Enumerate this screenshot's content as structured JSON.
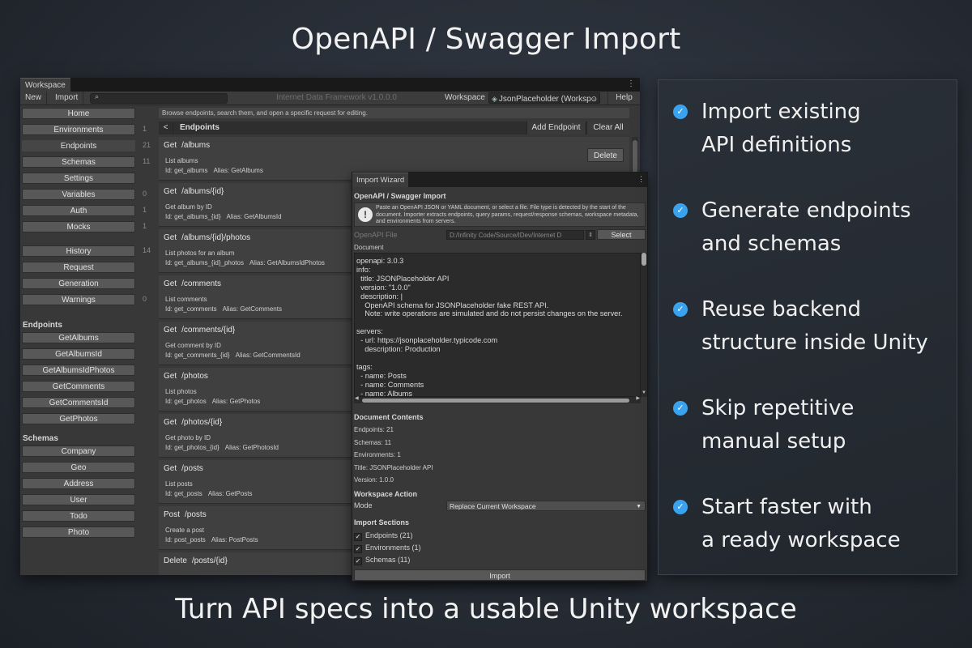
{
  "hero": {
    "title": "OpenAPI / Swagger Import",
    "subtitle": "Turn API specs into a usable Unity workspace"
  },
  "editor": {
    "tab": "Workspace",
    "menu_icon": "kebab-icon",
    "toolbar": {
      "new": "New",
      "import": "Import",
      "search_placeholder": "",
      "title": "Internet Data Framework v1.0.0.0",
      "workspace_label": "Workspace",
      "workspace_value": "JsonPlaceholder (Worksp",
      "help": "Help"
    },
    "sidebar": {
      "main_items": [
        {
          "label": "Home",
          "count": ""
        },
        {
          "label": "Environments",
          "count": "1"
        },
        {
          "label": "Endpoints",
          "count": "21",
          "active": true
        },
        {
          "label": "Schemas",
          "count": "11"
        },
        {
          "label": "Settings",
          "count": ""
        },
        {
          "label": "Variables",
          "count": "0"
        },
        {
          "label": "Auth",
          "count": "1"
        },
        {
          "label": "Mocks",
          "count": "1"
        }
      ],
      "secondary_items": [
        {
          "label": "History",
          "count": "14"
        },
        {
          "label": "Request",
          "count": ""
        },
        {
          "label": "Generation",
          "count": ""
        },
        {
          "label": "Warnings",
          "count": "0"
        }
      ],
      "endpoints_heading": "Endpoints",
      "endpoints": [
        "GetAlbums",
        "GetAlbumsId",
        "GetAlbumsIdPhotos",
        "GetComments",
        "GetCommentsId",
        "GetPhotos"
      ],
      "schemas_heading": "Schemas",
      "schemas": [
        "Company",
        "Geo",
        "Address",
        "User",
        "Todo",
        "Photo"
      ]
    },
    "main": {
      "info": "Browse endpoints, search them, and open a specific request for editing.",
      "back": "<",
      "header_title": "Endpoints",
      "add_endpoint": "Add Endpoint",
      "clear_all": "Clear All",
      "delete": "Delete",
      "endpoints": [
        {
          "method": "Get",
          "path": "/albums",
          "desc": "List albums",
          "id": "Id: get_albums",
          "alias": "Alias: GetAlbums"
        },
        {
          "method": "Get",
          "path": "/albums/{id}",
          "desc": "Get album by ID",
          "id": "Id: get_albums_{id}",
          "alias": "Alias: GetAlbumsId"
        },
        {
          "method": "Get",
          "path": "/albums/{id}/photos",
          "desc": "List photos for an album",
          "id": "Id: get_albums_{id}_photos",
          "alias": "Alias: GetAlbumsIdPhotos"
        },
        {
          "method": "Get",
          "path": "/comments",
          "desc": "List comments",
          "id": "Id: get_comments",
          "alias": "Alias: GetComments"
        },
        {
          "method": "Get",
          "path": "/comments/{id}",
          "desc": "Get comment by ID",
          "id": "Id: get_comments_{id}",
          "alias": "Alias: GetCommentsId"
        },
        {
          "method": "Get",
          "path": "/photos",
          "desc": "List photos",
          "id": "Id: get_photos",
          "alias": "Alias: GetPhotos"
        },
        {
          "method": "Get",
          "path": "/photos/{id}",
          "desc": "Get photo by ID",
          "id": "Id: get_photos_{id}",
          "alias": "Alias: GetPhotosId"
        },
        {
          "method": "Get",
          "path": "/posts",
          "desc": "List posts",
          "id": "Id: get_posts",
          "alias": "Alias: GetPosts"
        },
        {
          "method": "Post",
          "path": "/posts",
          "desc": "Create a post",
          "id": "Id: post_posts",
          "alias": "Alias: PostPosts"
        },
        {
          "method": "Delete",
          "path": "/posts/{id}",
          "desc": "",
          "id": "",
          "alias": ""
        }
      ]
    }
  },
  "wizard": {
    "tab": "Import Wizard",
    "heading": "OpenAPI / Swagger Import",
    "help_icon": "exclamation-icon",
    "help_text": "Paste an OpenAPI JSON or YAML document, or select a file. File type is detected by the start of the document. Importer extracts endpoints, query params, request/response schemas, workspace metadata, and environments from servers.",
    "file_label": "OpenAPI File",
    "file_value": "D:/Infinity Code/Source/IDev/Internet D",
    "select": "Select",
    "document_label": "Document",
    "document_lines": [
      "openapi: 3.0.3",
      "info:",
      "  title: JSONPlaceholder API",
      "  version: \"1.0.0\"",
      "  description: |",
      "    OpenAPI schema for JSONPlaceholder fake REST API.",
      "    Note: write operations are simulated and do not persist changes on the server.",
      "",
      "servers:",
      "  - url: https://jsonplaceholder.typicode.com",
      "    description: Production",
      "",
      "tags:",
      "  - name: Posts",
      "  - name: Comments",
      "  - name: Albums"
    ],
    "contents_heading": "Document Contents",
    "contents": [
      "Endpoints: 21",
      "Schemas: 11",
      "Environments: 1",
      "Title: JSONPlaceholder API",
      "Version: 1.0.0"
    ],
    "action_heading": "Workspace Action",
    "mode_label": "Mode",
    "mode_value": "Replace Current Workspace",
    "sections_heading": "Import Sections",
    "sections": [
      {
        "label": "Endpoints (21)",
        "checked": true
      },
      {
        "label": "Environments (1)",
        "checked": true
      },
      {
        "label": "Schemas (11)",
        "checked": true
      }
    ],
    "import": "Import"
  },
  "features": {
    "accent": "#3aa3f0",
    "items": [
      "Import existing\nAPI definitions",
      "Generate endpoints\nand schemas",
      "Reuse backend\nstructure inside Unity",
      "Skip repetitive\nmanual setup",
      "Start faster with\na ready workspace"
    ]
  }
}
